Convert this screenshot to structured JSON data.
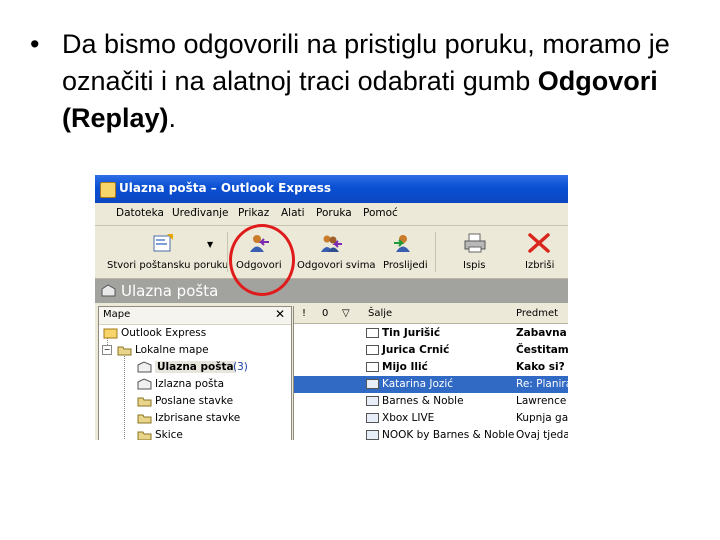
{
  "slide": {
    "bullet": "•",
    "text_before": "Da bismo odgovorili na pristiglu poruku, moramo je označiti i na alatnoj traci odabrati gumb ",
    "text_bold": "Odgovori (Replay)",
    "text_after": "."
  },
  "window": {
    "title": "Ulazna pošta – Outlook Express",
    "menu": [
      "Datoteka",
      "Uređivanje",
      "Prikaz",
      "Alati",
      "Poruka",
      "Pomoć"
    ],
    "toolbar": [
      {
        "label": "Stvori poštansku poruku",
        "icon": "new-mail-icon"
      },
      {
        "label": "Odgovori",
        "icon": "reply-icon"
      },
      {
        "label": "Odgovori svima",
        "icon": "reply-all-icon"
      },
      {
        "label": "Proslijedi",
        "icon": "forward-icon"
      },
      {
        "label": "Ispis",
        "icon": "printer-icon"
      },
      {
        "label": "Izbriši",
        "icon": "delete-icon"
      }
    ],
    "banner_title": "Ulazna pošta",
    "folders": {
      "header": "Mape",
      "close": "✕",
      "items": [
        {
          "label": "Outlook Express",
          "count": ""
        },
        {
          "label": "Lokalne mape",
          "count": ""
        },
        {
          "label": "Ulazna pošta",
          "count": "(3)"
        },
        {
          "label": "Izlazna pošta",
          "count": ""
        },
        {
          "label": "Poslane stavke",
          "count": ""
        },
        {
          "label": "Izbrisane stavke",
          "count": ""
        },
        {
          "label": "Skice",
          "count": ""
        }
      ]
    },
    "messages": {
      "columns": [
        "!",
        "0",
        "▽",
        "Šalje",
        "Predmet"
      ],
      "rows": [
        {
          "sender": "Tin Jurišić",
          "subject": "Zabavna",
          "unread": true
        },
        {
          "sender": "Jurica Crnić",
          "subject": "Čestitam",
          "unread": true
        },
        {
          "sender": "Mijo Ilić",
          "subject": "Kako si?",
          "unread": true
        },
        {
          "sender": "Katarina Jozić",
          "subject": "Re: Planira",
          "unread": false,
          "selected": true
        },
        {
          "sender": "Barnes & Noble",
          "subject": "Lawrence",
          "unread": false
        },
        {
          "sender": "Xbox LIVE",
          "subject": "Kupnja ga",
          "unread": false
        },
        {
          "sender": "NOOK by Barnes & Noble",
          "subject": "Ovaj tjeda",
          "unread": false
        }
      ]
    }
  },
  "colors": {
    "title_blue": "#0a4fd2",
    "selection": "#316ac5",
    "highlight_circle": "#e01b1b"
  }
}
